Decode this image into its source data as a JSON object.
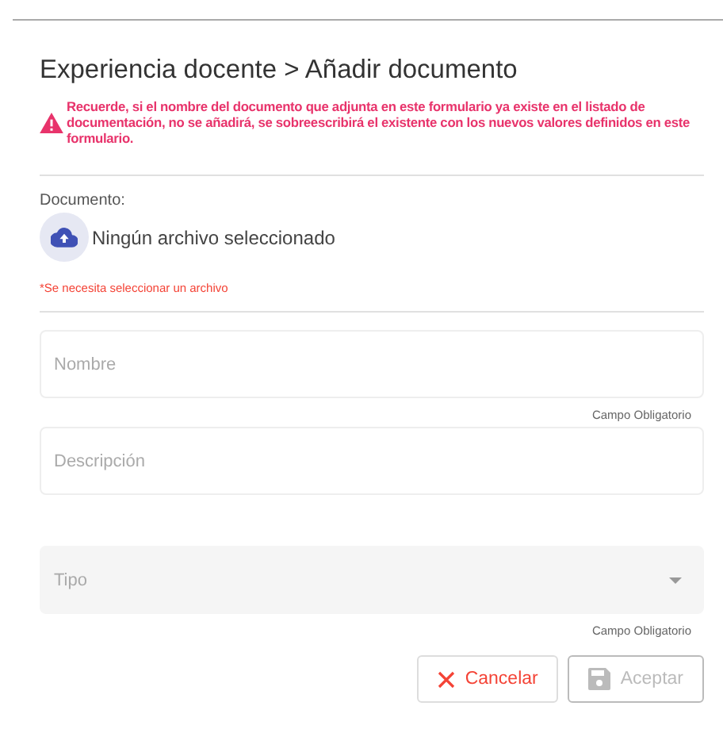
{
  "title": "Experiencia docente > Añadir documento",
  "warning": "Recuerde, si el nombre del documento que adjunta en este formulario ya existe en el listado de documentación, no se añadirá, se sobreescribirá el existente con los nuevos valores definidos en este formulario.",
  "file": {
    "label": "Documento:",
    "value": "Ningún archivo seleccionado",
    "error": "*Se necesita seleccionar un archivo"
  },
  "fields": [
    {
      "kind": "text",
      "placeholder": "Nombre",
      "hint": "Campo Obligatorio"
    },
    {
      "kind": "text",
      "placeholder": "Descripción"
    },
    {
      "kind": "select",
      "placeholder": "Tipo",
      "hint": "Campo Obligatorio"
    }
  ],
  "buttons": [
    {
      "kind": "cancel",
      "label": "Cancelar",
      "disabled": false
    },
    {
      "kind": "save",
      "label": "Aceptar",
      "disabled": true
    }
  ]
}
